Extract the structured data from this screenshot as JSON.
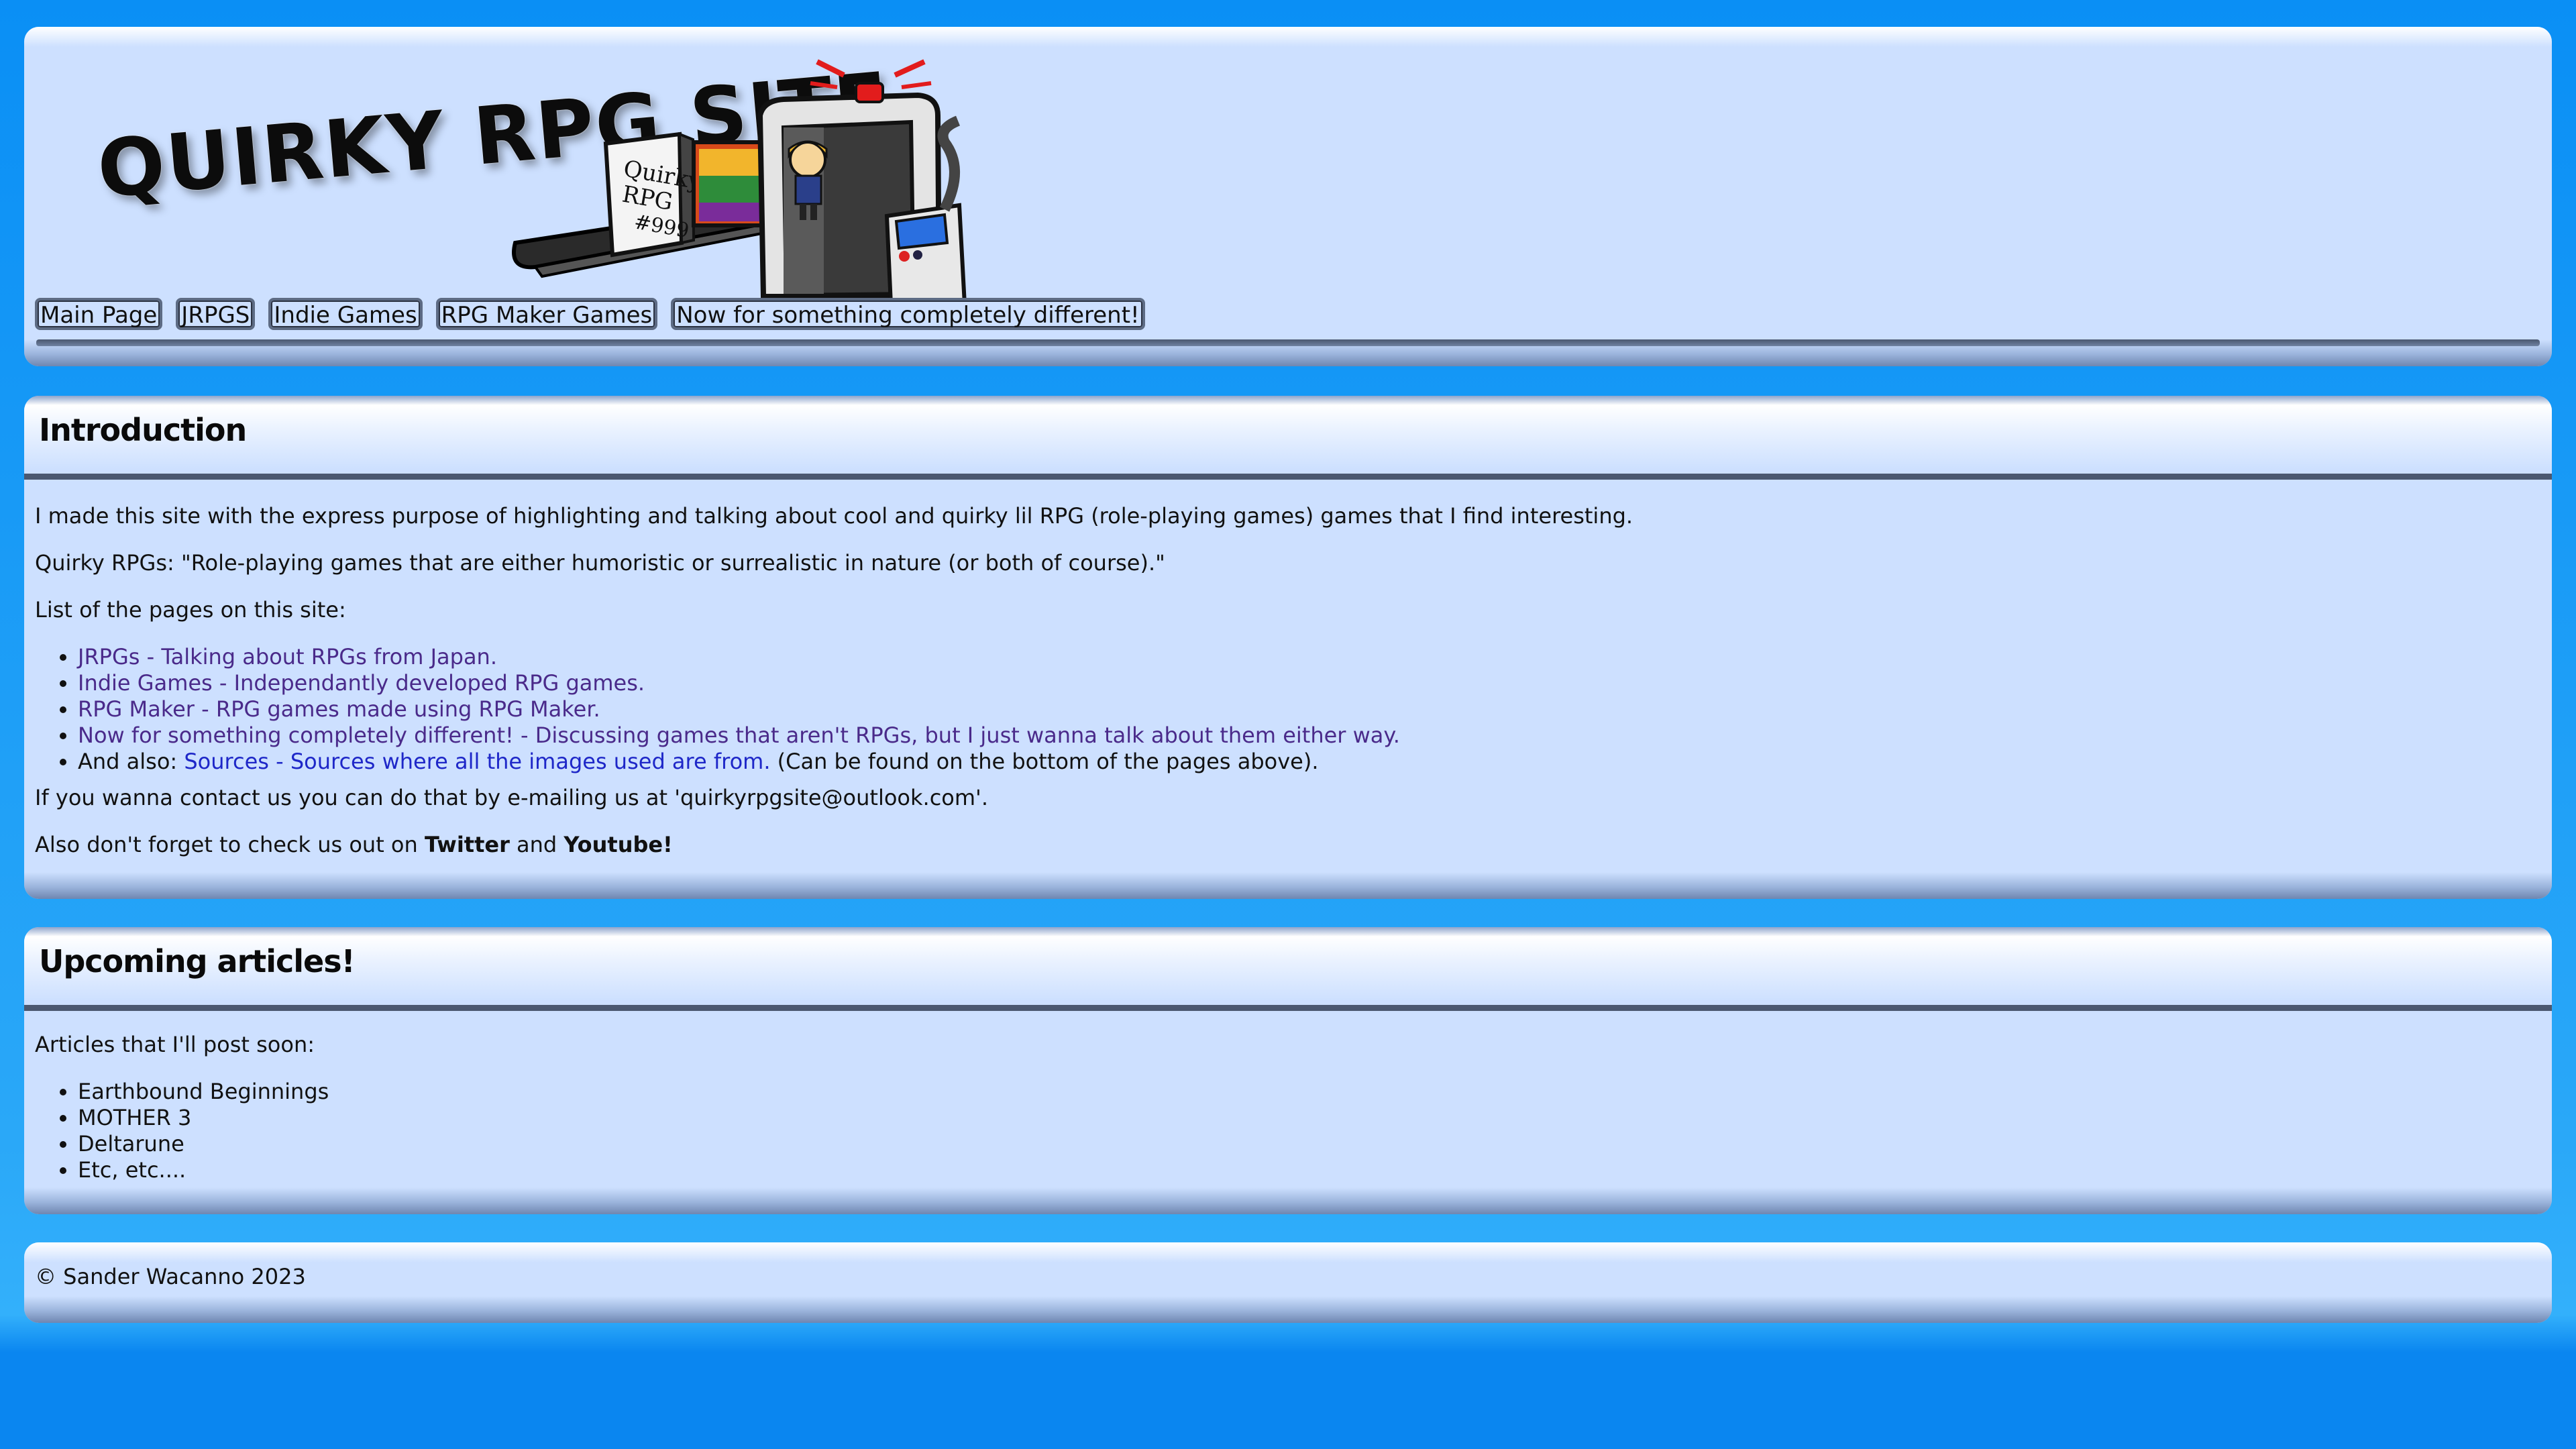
{
  "header": {
    "logo_text": "QUIRKY RPG SITE",
    "logo_box_text": "Quirky RPG #999",
    "nav": [
      {
        "label": "Main Page"
      },
      {
        "label": "JRPGS"
      },
      {
        "label": "Indie Games"
      },
      {
        "label": "RPG Maker Games"
      },
      {
        "label": "Now for something completely different!"
      }
    ]
  },
  "intro": {
    "title": "Introduction",
    "p1": "I made this site with the express purpose of highlighting and talking about cool and quirky lil RPG (role-playing games) games that I find interesting.",
    "p2": "Quirky RPGs: \"Role-playing games that are either humoristic or surrealistic in nature (or both of course).\"",
    "p3": "List of the pages on this site:",
    "pages": [
      {
        "link": "JRPGs - Talking about RPGs from Japan."
      },
      {
        "link": "Indie Games - Independantly developed RPG games."
      },
      {
        "link": "RPG Maker - RPG games made using RPG Maker."
      },
      {
        "link": "Now for something completely different! - Discussing games that aren't RPGs, but I just wanna talk about them either way."
      }
    ],
    "also_prefix": "And also: ",
    "also_link": "Sources - Sources where all the images used are from.",
    "also_suffix": " (Can be found on the bottom of the pages above).",
    "contact": "If you wanna contact us you can do that by e-mailing us at 'quirkyrpgsite@outlook.com'.",
    "social_prefix": "Also don't forget to check us out on ",
    "twitter": "Twitter",
    "social_and": " and ",
    "youtube": "Youtube!"
  },
  "upcoming": {
    "title": "Upcoming articles!",
    "intro": "Articles that I'll post soon:",
    "items": [
      "Earthbound Beginnings",
      "MOTHER 3",
      "Deltarune",
      "Etc, etc...."
    ]
  },
  "footer": {
    "copyright": "© Sander Wacanno 2023"
  },
  "colors": {
    "page_bg": "#0a8ff5",
    "panel_bg": "#cde0ff",
    "rule": "#4b5870",
    "visited_link": "#4a2a8a",
    "link": "#1e27c8"
  }
}
